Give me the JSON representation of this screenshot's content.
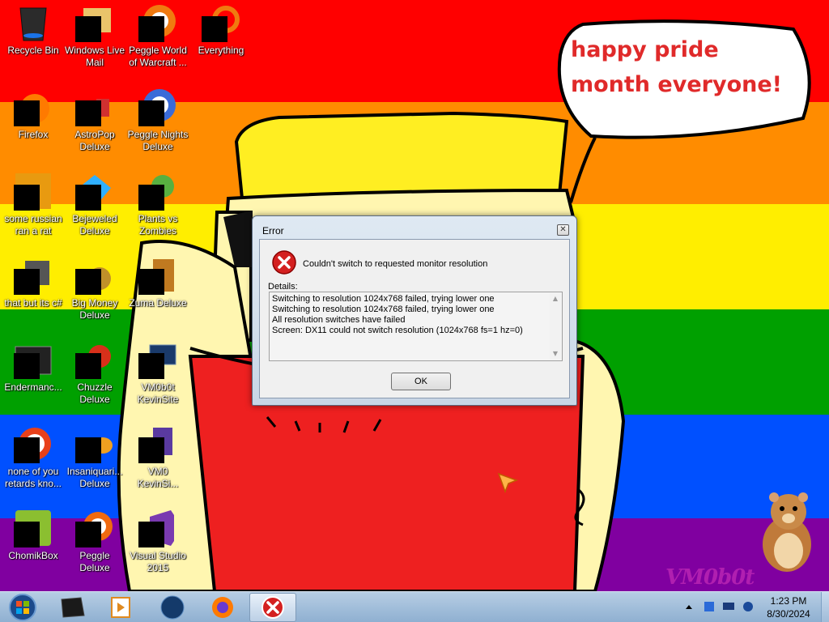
{
  "wallpaper": {
    "stripe_colors": [
      "#ff0000",
      "#ff8c00",
      "#ffee00",
      "#00a000",
      "#0050ff",
      "#8000a0"
    ],
    "speech_bubble_text": "happy pride month everyone!",
    "watermark_text": "VM0b0t"
  },
  "desktop_icons": [
    {
      "label": "Recycle Bin",
      "icon": "recycle-bin-icon"
    },
    {
      "label": "Windows Live Mail",
      "icon": "mail-icon"
    },
    {
      "label": "Peggle World of Warcraft ...",
      "icon": "peggle-wow-icon"
    },
    {
      "label": "Everything",
      "icon": "everything-search-icon"
    },
    {
      "label": "Firefox",
      "icon": "firefox-icon"
    },
    {
      "label": "AstroPop Deluxe",
      "icon": "astropop-icon"
    },
    {
      "label": "Peggle Nights Deluxe",
      "icon": "peggle-nights-icon"
    },
    {
      "label": "some russian ran a rat",
      "icon": "game-icon"
    },
    {
      "label": "Bejeweled Deluxe",
      "icon": "bejeweled-icon"
    },
    {
      "label": "Plants vs Zombies",
      "icon": "pvz-icon"
    },
    {
      "label": "that but its c#",
      "icon": "files-icon"
    },
    {
      "label": "Big Money Deluxe",
      "icon": "big-money-icon"
    },
    {
      "label": "Zuma Deluxe",
      "icon": "zuma-icon"
    },
    {
      "label": "Endermanc...",
      "icon": "terminal-icon"
    },
    {
      "label": "Chuzzle Deluxe",
      "icon": "chuzzle-icon"
    },
    {
      "label": "VM0b0t KevinSite",
      "icon": "monitor-icon"
    },
    {
      "label": "none of you retards kno...",
      "icon": "browser-icon"
    },
    {
      "label": "Insaniquari... Deluxe",
      "icon": "insaniquarium-icon"
    },
    {
      "label": "VM0 KevinSi...",
      "icon": "document-icon"
    },
    {
      "label": "ChomikBox",
      "icon": "chomikbox-icon"
    },
    {
      "label": "Peggle Deluxe",
      "icon": "peggle-icon"
    },
    {
      "label": "Visual Studio 2015",
      "icon": "visual-studio-icon"
    }
  ],
  "dialog": {
    "title": "Error",
    "close_glyph": "✕",
    "message": "Couldn't switch to requested monitor resolution",
    "details_label": "Details:",
    "details_lines": [
      "Switching to resolution 1024x768 failed, trying lower one",
      "Switching to resolution 1024x768 failed, trying lower one",
      "All resolution switches have failed",
      "Screen: DX11 could not switch resolution (1024x768 fs=1 hz=0)"
    ],
    "ok_label": "OK"
  },
  "taskbar": {
    "start_icon": "windows-orb-icon",
    "pinned": [
      "app-window-icon",
      "media-player-icon",
      "globe-icon",
      "firefox-icon",
      "error-icon"
    ],
    "tray_icons": [
      "show-hidden-icon",
      "network-icon",
      "monitor-icon",
      "volume-icon"
    ],
    "time": "1:23 PM",
    "date": "8/30/2024"
  }
}
